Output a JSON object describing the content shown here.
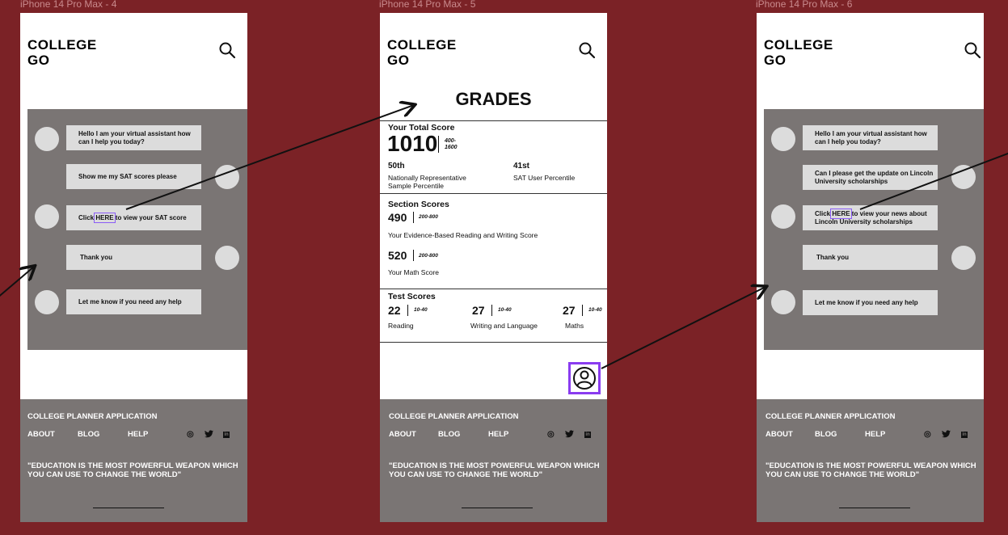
{
  "frames": [
    {
      "label": "iPhone 14 Pro Max - 4"
    },
    {
      "label": "iPhone 14 Pro Max - 5"
    },
    {
      "label": "iPhone 14 Pro Max - 6"
    }
  ],
  "header": {
    "logo_line1": "COLLEGE",
    "logo_line2": "GO",
    "search_icon": "search-icon"
  },
  "chat1": {
    "msg1": "Hello I am your virtual assistant how can I help you today?",
    "msg2": "Show me my SAT scores please",
    "msg3_pre": "Click ",
    "msg3_link": "HERE",
    "msg3_post": " to view your SAT score",
    "msg4": "Thank you",
    "msg5": "Let me know if you need any help"
  },
  "chat2": {
    "msg1": "Hello I am your virtual assistant how can I help you today?",
    "msg2": "Can I please get the update on Lincoln University scholarships",
    "msg3_pre": "Click ",
    "msg3_link": "HERE",
    "msg3_post": " to view your  news about Lincoln University scholarships",
    "msg4": "Thank you",
    "msg5": "Let me know if you need any help"
  },
  "grades": {
    "title": "GRADES",
    "total_label": "Your Total Score",
    "total_value": "1010",
    "total_range_top": "400-",
    "total_range_bottom": "1600",
    "pct1_value": "50th",
    "pct1_label_line1": "Nationally Representative",
    "pct1_label_line2": "Sample Percentile",
    "pct2_value": "41st",
    "pct2_label": "SAT User Percentile",
    "section_label": "Section Scores",
    "ebrw_value": "490",
    "ebrw_range": "200-800",
    "ebrw_label": "Your Evidence-Based Reading and Writing Score",
    "math_value": "520",
    "math_range": "200-800",
    "math_label": "Your Math Score",
    "test_label": "Test Scores",
    "reading_value": "22",
    "reading_range": "10-40",
    "reading_label": "Reading",
    "writing_value": "27",
    "writing_range": "10-40",
    "writing_label": "Writing and Language",
    "maths_value": "27",
    "maths_range": "10-40",
    "maths_label": "Maths",
    "profile_icon": "user-circle-icon"
  },
  "footer": {
    "title": "COLLEGE PLANNER APPLICATION",
    "about": "ABOUT",
    "blog": "BLOG",
    "help": "HELP",
    "instagram": "◎",
    "twitter": "🐦",
    "linkedin": "in",
    "quote": "\"EDUCATION IS THE MOST POWERFUL WEAPON WHICH YOU CAN USE TO CHANGE THE WORLD\""
  },
  "colors": {
    "background": "#7b2226",
    "panel": "#7a7574",
    "bubble": "#dcdcdc",
    "highlight": "#8a3cf0"
  }
}
